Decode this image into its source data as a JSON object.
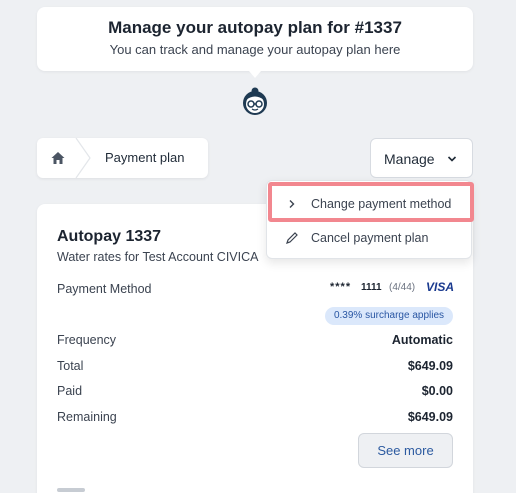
{
  "header": {
    "title": "Manage your autopay plan for #1337",
    "subtitle": "You can track and manage your autopay plan here"
  },
  "breadcrumb": {
    "label": "Payment plan",
    "home_icon": "home-icon"
  },
  "manage_menu": {
    "button_label": "Manage",
    "items": [
      {
        "label": "Change payment method",
        "icon": "chevron-right-icon"
      },
      {
        "label": "Cancel payment plan",
        "icon": "pencil-icon"
      }
    ]
  },
  "plan": {
    "title": "Autopay 1337",
    "subtitle": "Water rates for Test Account CIVICA",
    "payment_method": {
      "label": "Payment Method",
      "masked": "****",
      "last4": "1111",
      "expiry": "(4/44)",
      "brand": "VISA",
      "surcharge": "0.39% surcharge applies"
    },
    "rows": [
      {
        "label": "Frequency",
        "value": "Automatic"
      },
      {
        "label": "Total",
        "value": "$649.09"
      },
      {
        "label": "Paid",
        "value": "$0.00"
      },
      {
        "label": "Remaining",
        "value": "$649.09"
      }
    ],
    "see_more": "See more"
  },
  "colors": {
    "background": "#eef0f3",
    "accent": "#2c5aa0",
    "highlight": "#f2878f",
    "visa": "#1a3a8f"
  }
}
